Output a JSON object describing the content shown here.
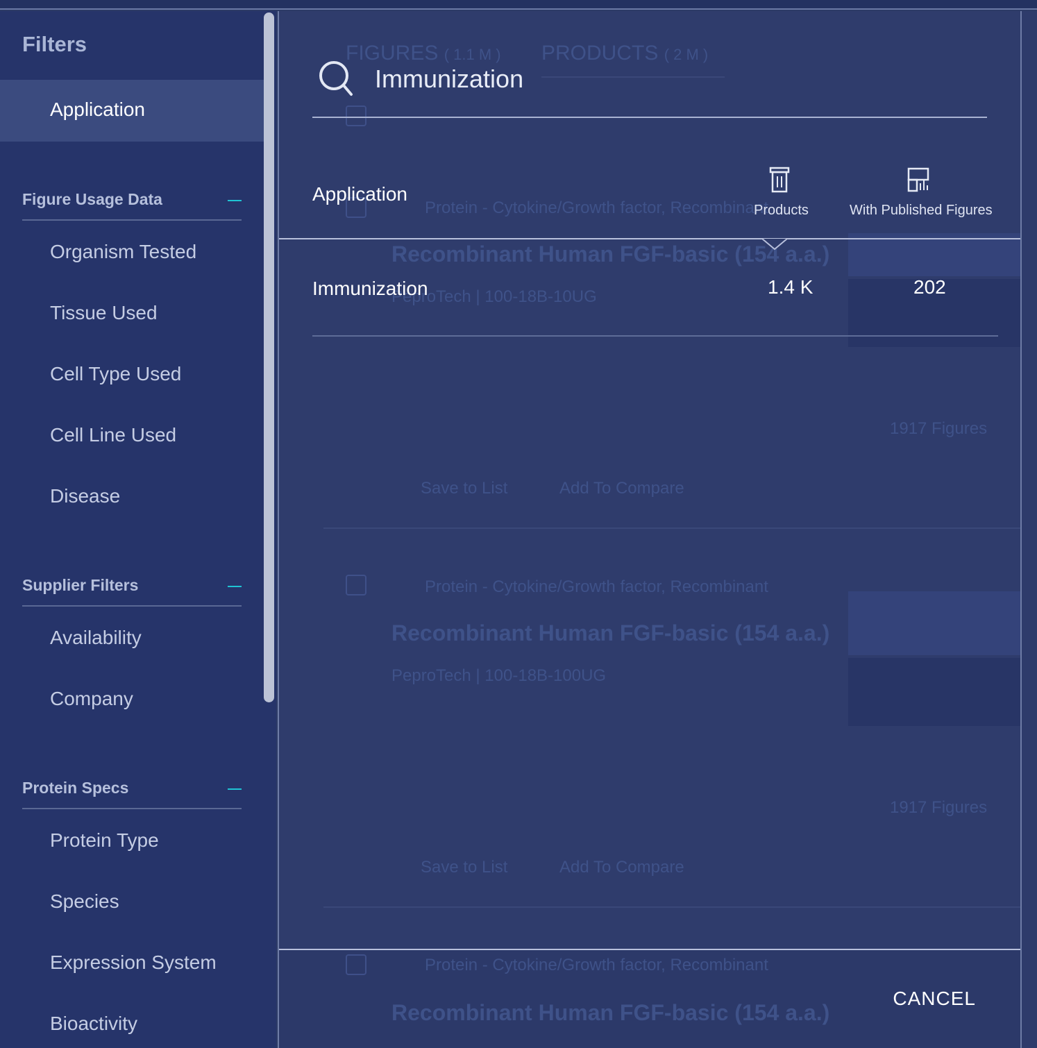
{
  "sidebar": {
    "title": "Filters",
    "active_item": "Application",
    "sections": [
      {
        "label": "Figure Usage Data",
        "items": [
          "Organism Tested",
          "Tissue Used",
          "Cell Type Used",
          "Cell Line Used",
          "Disease"
        ]
      },
      {
        "label": "Supplier Filters",
        "items": [
          "Availability",
          "Company"
        ]
      },
      {
        "label": "Protein Specs",
        "items": [
          "Protein Type",
          "Species",
          "Expression System",
          "Bioactivity"
        ]
      }
    ]
  },
  "background": {
    "tabs": [
      {
        "label": "FIGURES",
        "count": "( 1.1 M )"
      },
      {
        "label": "PRODUCTS",
        "count": "( 2 M )"
      }
    ],
    "results": [
      {
        "category": "Protein - Cytokine/Growth factor, Recombinant",
        "title": "Recombinant Human FGF-basic (154 a.a.)",
        "supplier": "PeproTech | 100-18B-10UG",
        "figures": "1917 Figures",
        "save": "Save to List",
        "compare": "Add To Compare"
      },
      {
        "category": "Protein - Cytokine/Growth factor, Recombinant",
        "title": "Recombinant Human FGF-basic (154 a.a.)",
        "supplier": "PeproTech | 100-18B-100UG",
        "figures": "1917 Figures",
        "save": "Save to List",
        "compare": "Add To Compare"
      },
      {
        "category": "Protein - Cytokine/Growth factor, Recombinant",
        "title": "Recombinant Human FGF-basic (154 a.a.)"
      }
    ]
  },
  "search": {
    "value": "Immunization",
    "icon": "search-icon"
  },
  "table": {
    "header": "Application",
    "col_products": "Products",
    "col_figures": "With Published Figures",
    "rows": [
      {
        "name": "Immunization",
        "products": "1.4 K",
        "figures": "202"
      }
    ]
  },
  "footer": {
    "cancel": "CANCEL"
  },
  "colors": {
    "accent": "#1fc4d4",
    "sidebar_bg": "#26346a",
    "active_bg": "#3b4b7f",
    "panel_bg": "#2f3c6c"
  }
}
